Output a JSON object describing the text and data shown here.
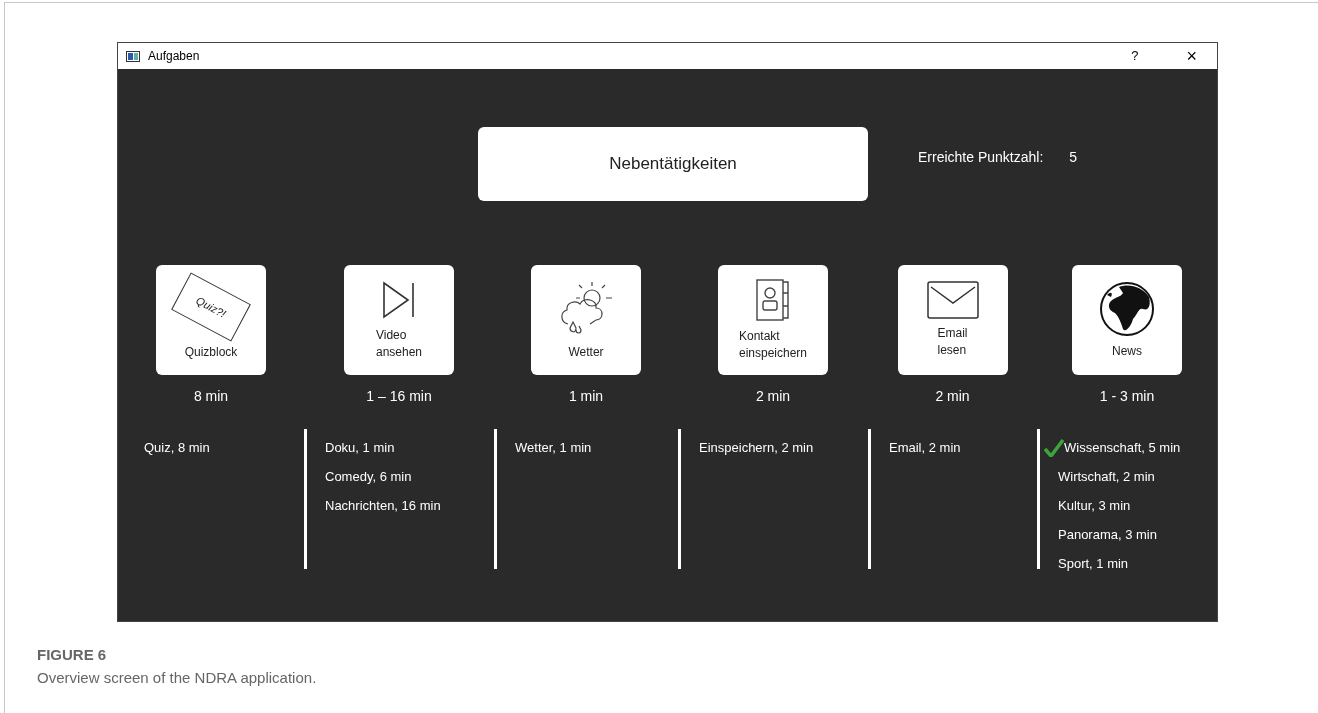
{
  "window": {
    "title": "Aufgaben",
    "help_button": "?",
    "close_button": "×"
  },
  "header": {
    "title": "Nebentätigkeiten",
    "score_label": "Erreichte Punktzahl:",
    "score_value": "5"
  },
  "tasks": [
    {
      "kind": "quiz",
      "label": "Quizblock",
      "icon_text": "Quiz?!",
      "duration": "8 min",
      "options": [
        {
          "text": "Quiz, 8 min",
          "checked": false
        }
      ]
    },
    {
      "kind": "video",
      "label": "Video\nansehen",
      "duration": "1 – 16 min",
      "options": [
        {
          "text": "Doku, 1 min",
          "checked": false
        },
        {
          "text": "Comedy, 6 min",
          "checked": false
        },
        {
          "text": "Nachrichten, 16 min",
          "checked": false
        }
      ]
    },
    {
      "kind": "weather",
      "label": "Wetter",
      "duration": "1 min",
      "options": [
        {
          "text": "Wetter, 1 min",
          "checked": false
        }
      ]
    },
    {
      "kind": "contact",
      "label": "Kontakt\neinspeichern",
      "duration": "2 min",
      "options": [
        {
          "text": "Einspeichern, 2 min",
          "checked": false
        }
      ]
    },
    {
      "kind": "email",
      "label": "Email\nlesen",
      "duration": "2 min",
      "options": [
        {
          "text": "Email, 2 min",
          "checked": false
        }
      ]
    },
    {
      "kind": "news",
      "label": "News",
      "duration": "1 - 3 min",
      "options": [
        {
          "text": "Wissenschaft, 5 min",
          "checked": true
        },
        {
          "text": "Wirtschaft, 2 min",
          "checked": false
        },
        {
          "text": "Kultur, 3 min",
          "checked": false
        },
        {
          "text": "Panorama, 3 min",
          "checked": false
        },
        {
          "text": "Sport, 1 min",
          "checked": false
        }
      ]
    }
  ],
  "caption": {
    "label": "FIGURE 6",
    "text": "Overview screen of the NDRA application."
  }
}
